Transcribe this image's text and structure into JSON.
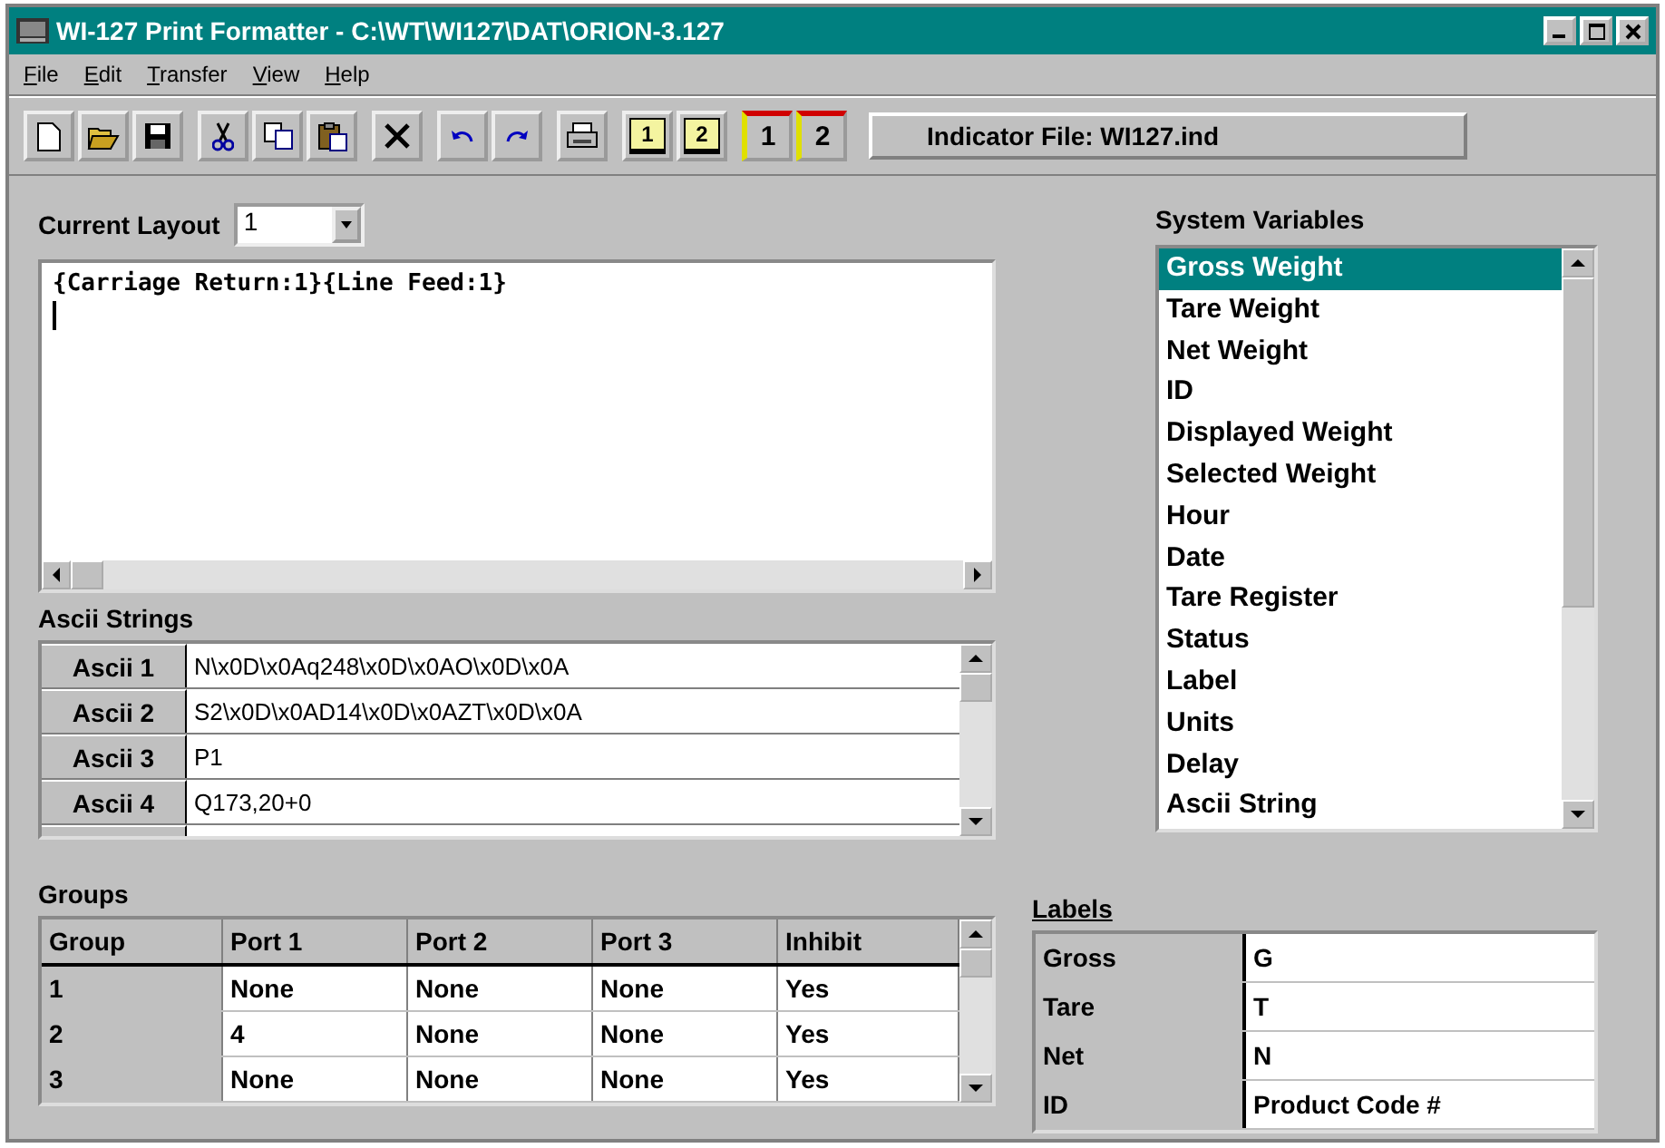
{
  "window": {
    "title": "WI-127 Print Formatter - C:\\WT\\WI127\\DAT\\ORION-3.127"
  },
  "menu": [
    "File",
    "Edit",
    "Transfer",
    "View",
    "Help"
  ],
  "toolbar": {
    "groups": [
      [
        {
          "kind": "new"
        },
        {
          "kind": "open"
        },
        {
          "kind": "save"
        }
      ],
      [
        {
          "kind": "cut"
        },
        {
          "kind": "copy"
        },
        {
          "kind": "paste"
        }
      ],
      [
        {
          "kind": "delete"
        }
      ],
      [
        {
          "kind": "undo"
        },
        {
          "kind": "redo"
        }
      ],
      [
        {
          "kind": "print"
        }
      ],
      [
        {
          "kind": "monitor",
          "label": "1"
        },
        {
          "kind": "monitor",
          "label": "2"
        }
      ],
      [
        {
          "kind": "numbered",
          "label": "1"
        },
        {
          "kind": "numbered",
          "label": "2"
        }
      ]
    ],
    "indicator": "Indicator File: WI127.ind"
  },
  "layout": {
    "label": "Current Layout",
    "value": "1",
    "text": "{Carriage Return:1}{Line Feed:1}"
  },
  "ascii": {
    "title": "Ascii Strings",
    "rows": [
      {
        "name": "Ascii 1",
        "value": "N\\x0D\\x0Aq248\\x0D\\x0AO\\x0D\\x0A"
      },
      {
        "name": "Ascii 2",
        "value": "S2\\x0D\\x0AD14\\x0D\\x0AZT\\x0D\\x0A"
      },
      {
        "name": "Ascii 3",
        "value": "P1"
      },
      {
        "name": "Ascii 4",
        "value": "Q173,20+0"
      }
    ]
  },
  "system_variables": {
    "title": "System Variables",
    "items": [
      {
        "label": "Gross Weight",
        "selected": true
      },
      {
        "label": "Tare Weight",
        "selected": false
      },
      {
        "label": "Net Weight",
        "selected": false
      },
      {
        "label": "ID",
        "selected": false
      },
      {
        "label": "Displayed Weight",
        "selected": false
      },
      {
        "label": "Selected Weight",
        "selected": false
      },
      {
        "label": "Hour",
        "selected": false
      },
      {
        "label": "Date",
        "selected": false
      },
      {
        "label": "Tare Register",
        "selected": false
      },
      {
        "label": "Status",
        "selected": false
      },
      {
        "label": "Label",
        "selected": false
      },
      {
        "label": "Units",
        "selected": false
      },
      {
        "label": "Delay",
        "selected": false
      },
      {
        "label": "Ascii String",
        "selected": false
      }
    ]
  },
  "groups": {
    "title": "Groups",
    "columns": [
      "Group",
      "Port 1",
      "Port 2",
      "Port 3",
      "Inhibit"
    ],
    "rows": [
      [
        "1",
        "None",
        "None",
        "None",
        "Yes"
      ],
      [
        "2",
        "4",
        "None",
        "None",
        "Yes"
      ],
      [
        "3",
        "None",
        "None",
        "None",
        "Yes"
      ]
    ]
  },
  "labels": {
    "title": "Labels",
    "rows": [
      {
        "name": "Gross",
        "value": "G"
      },
      {
        "name": "Tare",
        "value": "T"
      },
      {
        "name": "Net",
        "value": "N"
      },
      {
        "name": "ID",
        "value": "Product Code #"
      }
    ]
  }
}
